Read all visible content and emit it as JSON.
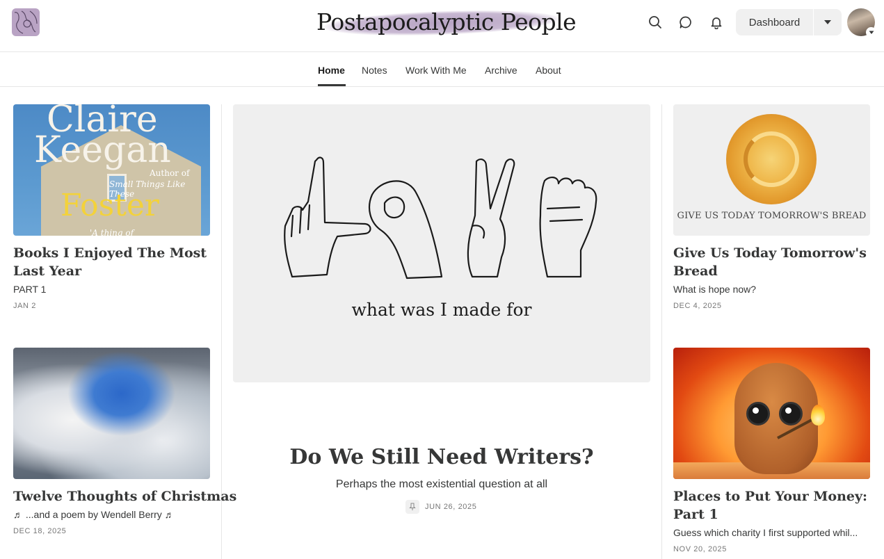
{
  "header": {
    "publication_name": "Postapocalyptic People",
    "dashboard_label": "Dashboard"
  },
  "nav": {
    "items": [
      {
        "label": "Home",
        "active": true
      },
      {
        "label": "Notes"
      },
      {
        "label": "Work With Me"
      },
      {
        "label": "Archive"
      },
      {
        "label": "About"
      }
    ]
  },
  "posts": {
    "left": [
      {
        "title": "Books I Enjoyed The Most Last Year",
        "subtitle": "PART 1",
        "date": "JAN 2",
        "cover": {
          "author_first": "Claire",
          "author_last": "Keegan",
          "author_of": "Author of",
          "other_title": "Small Things Like These",
          "book_title": "Foster",
          "quote": "'A thing of"
        }
      },
      {
        "title": "Twelve Thoughts of Christmas",
        "subtitle": "♬ ...and a poem by Wendell Berry ♬",
        "date": "DEC 18, 2025"
      }
    ],
    "featured": {
      "title": "Do We Still Need Writers?",
      "subtitle": "Perhaps the most existential question at all",
      "date": "JUN 26, 2025",
      "image_caption": "what was I made for"
    },
    "right": [
      {
        "title": "Give Us Today Tomorrow's Bread",
        "subtitle": "What is hope now?",
        "date": "DEC 4, 2025",
        "image_caption": "GIVE US TODAY TOMORROW'S BREAD"
      },
      {
        "title": "Places to Put Your Money: Part 1",
        "subtitle": "Guess which charity I first supported whil...",
        "date": "NOV 20, 2025"
      }
    ]
  },
  "icons": {
    "search": "search-icon",
    "chat": "chat-bubble-icon",
    "notifications": "bell-icon",
    "dropdown": "caret-down-icon",
    "pin": "pin-icon"
  },
  "colors": {
    "text": "#363737",
    "divider": "#e6e6e6",
    "button_bg": "#f0f0f0",
    "wordmark_swash": "#b7a4c4"
  }
}
